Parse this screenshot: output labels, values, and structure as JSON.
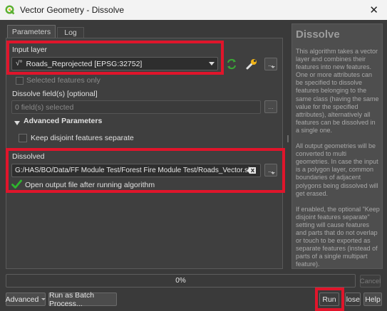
{
  "window": {
    "title": "Vector Geometry - Dissolve",
    "close_glyph": "✕"
  },
  "tabs": [
    {
      "label": "Parameters"
    },
    {
      "label": "Log"
    }
  ],
  "input_layer": {
    "label": "Input layer",
    "value": "Roads_Reprojected [EPSG:32752]",
    "layer_type_glyph": "√°"
  },
  "selected_only": {
    "label": "Selected features only",
    "checked": false
  },
  "dissolve_fields": {
    "label": "Dissolve field(s) [optional]",
    "value": "0 field(s) selected",
    "button_label": "..."
  },
  "advanced": {
    "label": "Advanced Parameters",
    "keep_disjoint_label": "Keep disjoint features separate",
    "keep_disjoint_checked": false
  },
  "output": {
    "label": "Dissolved",
    "value": "G:/HAS/BO/Data/FF Module Test/Forest Fire Module Test/Roads_Vector.shp",
    "open_after_label": "Open output file after running algorithm",
    "open_after_checked": true,
    "button_label": "..."
  },
  "help": {
    "title": "Dissolve",
    "paragraphs": [
      "This algorithm takes a vector layer and combines their features into new features. One or more attributes can be specified to dissolve features belonging to the same class (having the same value for the specified attributes), alternatively all features can be dissolved in a single one.",
      "All output geometries will be converted to multi geometries. In case the input is a polygon layer, common boundaries of adjacent polygons being dissolved will get erased.",
      "If enabled, the optional \"Keep disjoint features separate\" setting will cause features and parts that do not overlap or touch to be exported as separate features (instead of parts of a single multipart feature)."
    ]
  },
  "progress": {
    "text": "0%",
    "value": 0
  },
  "buttons": {
    "cancel": "Cancel",
    "advanced": "Advanced",
    "batch": "Run as Batch Process...",
    "run": "Run",
    "close": "Close",
    "help": "Help"
  },
  "icons": {
    "app": "qgis-icon",
    "iterate": "iterate-icon",
    "settings": "wrench-icon"
  },
  "colors": {
    "highlight": "#e0152b",
    "accent_green": "#3aa836",
    "check_green": "#2db52d"
  }
}
